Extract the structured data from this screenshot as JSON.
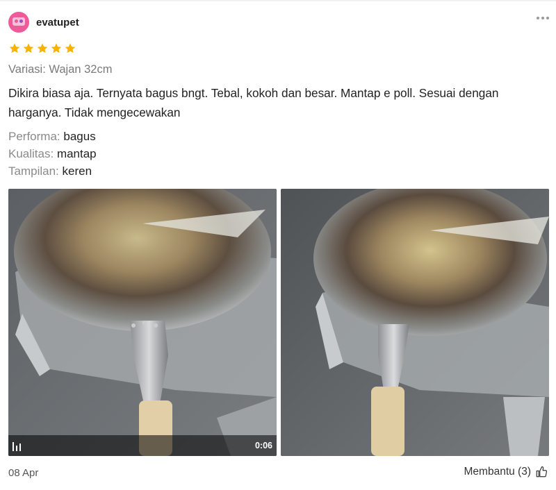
{
  "reviewer": {
    "name": "evatupet",
    "avatar_icon": "avatar-icon"
  },
  "rating": {
    "stars": 5,
    "max": 5,
    "color": "#f6b400"
  },
  "variant": "Variasi: Wajan 32cm",
  "review_text": "Dikira biasa aja. Ternyata bagus bngt. Tebal, kokoh dan besar. Mantap e poll. Sesuai dengan harganya. Tidak mengecewakan",
  "attributes": [
    {
      "label": "Performa:",
      "value": "bagus"
    },
    {
      "label": "Kualitas:",
      "value": "mantap"
    },
    {
      "label": "Tampilan:",
      "value": "keren"
    }
  ],
  "media": {
    "video_duration": "0:06",
    "video_icon": "equalizer-icon"
  },
  "footer": {
    "date": "08 Apr",
    "helpful_label": "Membantu (3)",
    "helpful_icon": "thumbs-up-icon"
  }
}
